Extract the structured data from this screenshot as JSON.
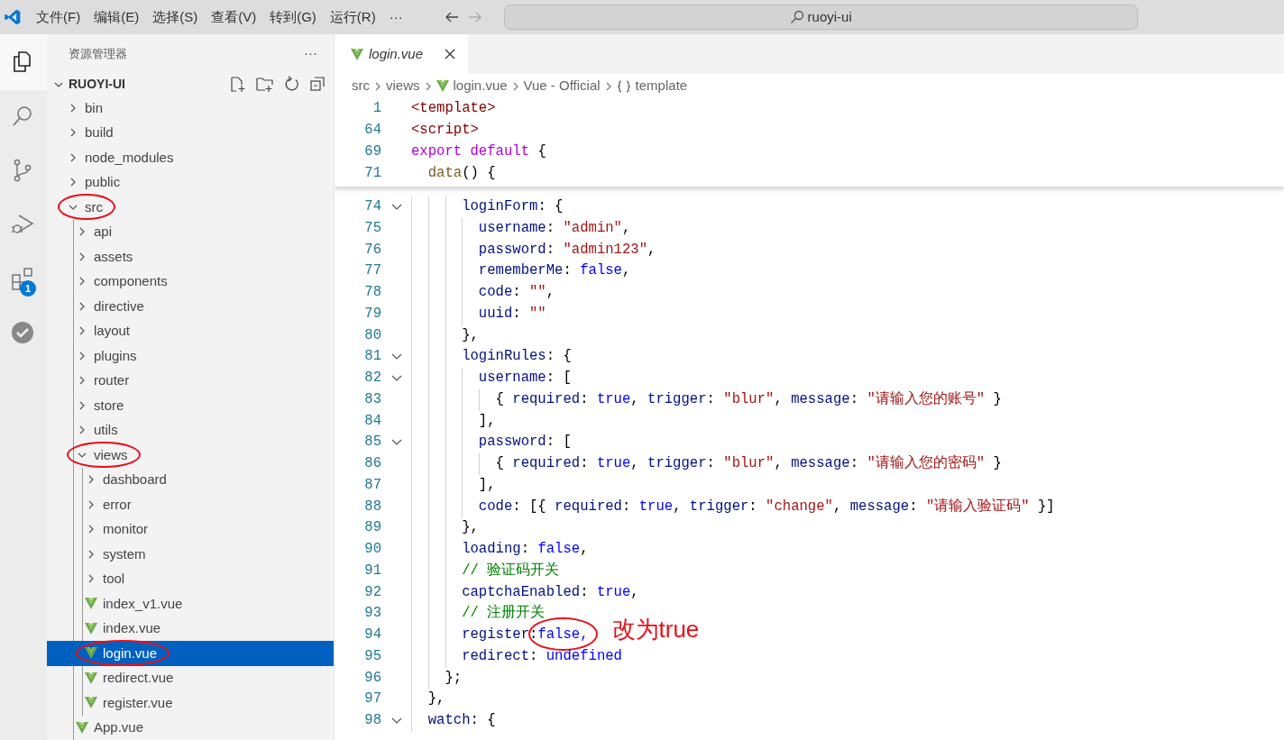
{
  "menu": [
    {
      "label": "文件(F)"
    },
    {
      "label": "编辑(E)"
    },
    {
      "label": "选择(S)"
    },
    {
      "label": "查看(V)"
    },
    {
      "label": "转到(G)"
    },
    {
      "label": "运行(R)"
    },
    {
      "label": "···"
    }
  ],
  "nav": [
    {
      "kind": "back",
      "disabled": false
    },
    {
      "kind": "forward",
      "disabled": true
    }
  ],
  "command_center": {
    "text": "ruoyi-ui"
  },
  "activity_bar": [
    {
      "kind": "explorer",
      "selected": true
    },
    {
      "kind": "search",
      "selected": false
    },
    {
      "kind": "source-control",
      "selected": false
    },
    {
      "kind": "run-debug",
      "selected": false
    },
    {
      "kind": "extensions",
      "selected": false,
      "badge": "1"
    },
    {
      "kind": "check",
      "selected": false
    }
  ],
  "explorer": {
    "title": "资源管理器",
    "more": "···",
    "root": {
      "label": "RUOYI-UI",
      "expanded": true
    },
    "tree": [
      {
        "label": "bin",
        "kind": "folder",
        "expanded": false,
        "selected": false,
        "circled": false
      },
      {
        "label": "build",
        "kind": "folder",
        "expanded": false,
        "selected": false,
        "circled": false
      },
      {
        "label": "node_modules",
        "kind": "folder",
        "expanded": false,
        "selected": false,
        "circled": false
      },
      {
        "label": "public",
        "kind": "folder",
        "expanded": false,
        "selected": false,
        "circled": false
      },
      {
        "label": "src",
        "kind": "folder",
        "expanded": true,
        "selected": false,
        "circled": true,
        "children": [
          {
            "label": "api",
            "kind": "folder",
            "expanded": false,
            "selected": false,
            "circled": false
          },
          {
            "label": "assets",
            "kind": "folder",
            "expanded": false,
            "selected": false,
            "circled": false
          },
          {
            "label": "components",
            "kind": "folder",
            "expanded": false,
            "selected": false,
            "circled": false
          },
          {
            "label": "directive",
            "kind": "folder",
            "expanded": false,
            "selected": false,
            "circled": false
          },
          {
            "label": "layout",
            "kind": "folder",
            "expanded": false,
            "selected": false,
            "circled": false
          },
          {
            "label": "plugins",
            "kind": "folder",
            "expanded": false,
            "selected": false,
            "circled": false
          },
          {
            "label": "router",
            "kind": "folder",
            "expanded": false,
            "selected": false,
            "circled": false
          },
          {
            "label": "store",
            "kind": "folder",
            "expanded": false,
            "selected": false,
            "circled": false
          },
          {
            "label": "utils",
            "kind": "folder",
            "expanded": false,
            "selected": false,
            "circled": false
          },
          {
            "label": "views",
            "kind": "folder",
            "expanded": true,
            "selected": false,
            "circled": true,
            "children": [
              {
                "label": "dashboard",
                "kind": "folder",
                "expanded": false,
                "selected": false,
                "circled": false
              },
              {
                "label": "error",
                "kind": "folder",
                "expanded": false,
                "selected": false,
                "circled": false
              },
              {
                "label": "monitor",
                "kind": "folder",
                "expanded": false,
                "selected": false,
                "circled": false
              },
              {
                "label": "system",
                "kind": "folder",
                "expanded": false,
                "selected": false,
                "circled": false
              },
              {
                "label": "tool",
                "kind": "folder",
                "expanded": false,
                "selected": false,
                "circled": false
              },
              {
                "label": "index_v1.vue",
                "kind": "vue",
                "selected": false,
                "circled": false
              },
              {
                "label": "index.vue",
                "kind": "vue",
                "selected": false,
                "circled": false
              },
              {
                "label": "login.vue",
                "kind": "vue",
                "selected": true,
                "circled": true
              },
              {
                "label": "redirect.vue",
                "kind": "vue",
                "selected": false,
                "circled": false
              },
              {
                "label": "register.vue",
                "kind": "vue",
                "selected": false,
                "circled": false
              }
            ]
          },
          {
            "label": "App.vue",
            "kind": "vue",
            "selected": false,
            "circled": false
          }
        ]
      }
    ]
  },
  "tabs": [
    {
      "label": "login.vue",
      "selected": true,
      "italic": true
    }
  ],
  "breadcrumb": [
    {
      "text": "src",
      "kind": "plain"
    },
    {
      "text": "views",
      "kind": "plain"
    },
    {
      "text": "login.vue",
      "kind": "vue"
    },
    {
      "text": "Vue - Official",
      "kind": "plain"
    },
    {
      "text": "template",
      "kind": "braces"
    }
  ],
  "sticky_lines": [
    {
      "number": "1",
      "tokens": [
        {
          "kind": "tag",
          "text": "<template>"
        }
      ]
    },
    {
      "number": "64",
      "tokens": [
        {
          "kind": "tag",
          "text": "<script>"
        }
      ]
    },
    {
      "number": "69",
      "tokens": [
        {
          "kind": "keyword",
          "text": "export"
        },
        {
          "kind": "keyword",
          "text": " default"
        },
        {
          "kind": "plain",
          "text": " {"
        }
      ]
    },
    {
      "number": "71",
      "tokens": [
        {
          "kind": "function",
          "text": "  data"
        },
        {
          "kind": "plain",
          "text": "() {"
        }
      ]
    }
  ],
  "lines": [
    {
      "number": "74",
      "fold": true,
      "tokens": [
        {
          "kind": "property",
          "text": "      loginForm"
        },
        {
          "kind": "plain",
          "text": ": {"
        }
      ]
    },
    {
      "number": "75",
      "fold": false,
      "tokens": [
        {
          "kind": "property",
          "text": "        username"
        },
        {
          "kind": "plain",
          "text": ": "
        },
        {
          "kind": "string",
          "text": "\"admin\""
        },
        {
          "kind": "plain",
          "text": ","
        }
      ]
    },
    {
      "number": "76",
      "fold": false,
      "tokens": [
        {
          "kind": "property",
          "text": "        password"
        },
        {
          "kind": "plain",
          "text": ": "
        },
        {
          "kind": "string",
          "text": "\"admin123\""
        },
        {
          "kind": "plain",
          "text": ","
        }
      ]
    },
    {
      "number": "77",
      "fold": false,
      "tokens": [
        {
          "kind": "property",
          "text": "        rememberMe"
        },
        {
          "kind": "plain",
          "text": ": "
        },
        {
          "kind": "boolean",
          "text": "false"
        },
        {
          "kind": "plain",
          "text": ","
        }
      ]
    },
    {
      "number": "78",
      "fold": false,
      "tokens": [
        {
          "kind": "property",
          "text": "        code"
        },
        {
          "kind": "plain",
          "text": ": "
        },
        {
          "kind": "string",
          "text": "\"\""
        },
        {
          "kind": "plain",
          "text": ","
        }
      ]
    },
    {
      "number": "79",
      "fold": false,
      "tokens": [
        {
          "kind": "property",
          "text": "        uuid"
        },
        {
          "kind": "plain",
          "text": ": "
        },
        {
          "kind": "string",
          "text": "\"\""
        }
      ]
    },
    {
      "number": "80",
      "fold": false,
      "tokens": [
        {
          "kind": "plain",
          "text": "      },"
        }
      ]
    },
    {
      "number": "81",
      "fold": true,
      "tokens": [
        {
          "kind": "property",
          "text": "      loginRules"
        },
        {
          "kind": "plain",
          "text": ": {"
        }
      ]
    },
    {
      "number": "82",
      "fold": true,
      "tokens": [
        {
          "kind": "property",
          "text": "        username"
        },
        {
          "kind": "plain",
          "text": ": ["
        }
      ]
    },
    {
      "number": "83",
      "fold": false,
      "tokens": [
        {
          "kind": "plain",
          "text": "          { "
        },
        {
          "kind": "property",
          "text": "required"
        },
        {
          "kind": "plain",
          "text": ": "
        },
        {
          "kind": "boolean",
          "text": "true"
        },
        {
          "kind": "plain",
          "text": ", "
        },
        {
          "kind": "property",
          "text": "trigger"
        },
        {
          "kind": "plain",
          "text": ": "
        },
        {
          "kind": "string",
          "text": "\"blur\""
        },
        {
          "kind": "plain",
          "text": ", "
        },
        {
          "kind": "property",
          "text": "message"
        },
        {
          "kind": "plain",
          "text": ": "
        },
        {
          "kind": "string",
          "text": "\"请输入您的账号\""
        },
        {
          "kind": "plain",
          "text": " }"
        }
      ]
    },
    {
      "number": "84",
      "fold": false,
      "tokens": [
        {
          "kind": "plain",
          "text": "        ],"
        }
      ]
    },
    {
      "number": "85",
      "fold": true,
      "tokens": [
        {
          "kind": "property",
          "text": "        password"
        },
        {
          "kind": "plain",
          "text": ": ["
        }
      ]
    },
    {
      "number": "86",
      "fold": false,
      "tokens": [
        {
          "kind": "plain",
          "text": "          { "
        },
        {
          "kind": "property",
          "text": "required"
        },
        {
          "kind": "plain",
          "text": ": "
        },
        {
          "kind": "boolean",
          "text": "true"
        },
        {
          "kind": "plain",
          "text": ", "
        },
        {
          "kind": "property",
          "text": "trigger"
        },
        {
          "kind": "plain",
          "text": ": "
        },
        {
          "kind": "string",
          "text": "\"blur\""
        },
        {
          "kind": "plain",
          "text": ", "
        },
        {
          "kind": "property",
          "text": "message"
        },
        {
          "kind": "plain",
          "text": ": "
        },
        {
          "kind": "string",
          "text": "\"请输入您的密码\""
        },
        {
          "kind": "plain",
          "text": " }"
        }
      ]
    },
    {
      "number": "87",
      "fold": false,
      "tokens": [
        {
          "kind": "plain",
          "text": "        ],"
        }
      ]
    },
    {
      "number": "88",
      "fold": false,
      "tokens": [
        {
          "kind": "property",
          "text": "        code"
        },
        {
          "kind": "plain",
          "text": ": [{ "
        },
        {
          "kind": "property",
          "text": "required"
        },
        {
          "kind": "plain",
          "text": ": "
        },
        {
          "kind": "boolean",
          "text": "true"
        },
        {
          "kind": "plain",
          "text": ", "
        },
        {
          "kind": "property",
          "text": "trigger"
        },
        {
          "kind": "plain",
          "text": ": "
        },
        {
          "kind": "string",
          "text": "\"change\""
        },
        {
          "kind": "plain",
          "text": ", "
        },
        {
          "kind": "property",
          "text": "message"
        },
        {
          "kind": "plain",
          "text": ": "
        },
        {
          "kind": "string",
          "text": "\"请输入验证码\""
        },
        {
          "kind": "plain",
          "text": " }]"
        }
      ]
    },
    {
      "number": "89",
      "fold": false,
      "tokens": [
        {
          "kind": "plain",
          "text": "      },"
        }
      ]
    },
    {
      "number": "90",
      "fold": false,
      "tokens": [
        {
          "kind": "property",
          "text": "      loading"
        },
        {
          "kind": "plain",
          "text": ": "
        },
        {
          "kind": "boolean",
          "text": "false"
        },
        {
          "kind": "plain",
          "text": ","
        }
      ]
    },
    {
      "number": "91",
      "fold": false,
      "tokens": [
        {
          "kind": "comment",
          "text": "      // 验证码开关"
        }
      ]
    },
    {
      "number": "92",
      "fold": false,
      "tokens": [
        {
          "kind": "property",
          "text": "      captchaEnabled"
        },
        {
          "kind": "plain",
          "text": ": "
        },
        {
          "kind": "boolean",
          "text": "true"
        },
        {
          "kind": "plain",
          "text": ","
        }
      ]
    },
    {
      "number": "93",
      "fold": false,
      "tokens": [
        {
          "kind": "comment",
          "text": "      // 注册开关"
        }
      ]
    },
    {
      "number": "94",
      "fold": false,
      "tokens": [
        {
          "kind": "property",
          "text": "      register"
        },
        {
          "kind": "plain",
          "text": ":"
        },
        {
          "kind": "circled",
          "text": "false,"
        }
      ],
      "note": "改为true"
    },
    {
      "number": "95",
      "fold": false,
      "tokens": [
        {
          "kind": "property",
          "text": "      redirect"
        },
        {
          "kind": "plain",
          "text": ": "
        },
        {
          "kind": "boolean",
          "text": "undefined"
        }
      ]
    },
    {
      "number": "96",
      "fold": false,
      "tokens": [
        {
          "kind": "plain",
          "text": "    };"
        }
      ]
    },
    {
      "number": "97",
      "fold": false,
      "tokens": [
        {
          "kind": "plain",
          "text": "  },"
        }
      ]
    },
    {
      "number": "98",
      "fold": true,
      "tokens": [
        {
          "kind": "property",
          "text": "  watch"
        },
        {
          "kind": "plain",
          "text": ": {"
        }
      ]
    }
  ]
}
